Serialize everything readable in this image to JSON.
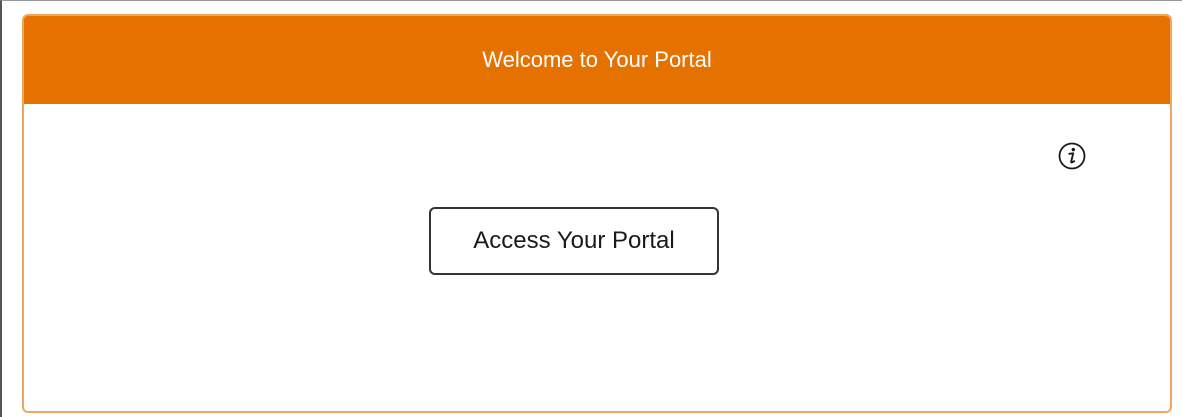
{
  "header": {
    "title": "Welcome to Your Portal"
  },
  "main": {
    "access_button_label": "Access Your Portal",
    "info_icon": "info-icon"
  },
  "colors": {
    "header_background": "#e57200",
    "card_border": "#f0a860",
    "header_text": "#ffffff",
    "button_border": "#333333"
  }
}
